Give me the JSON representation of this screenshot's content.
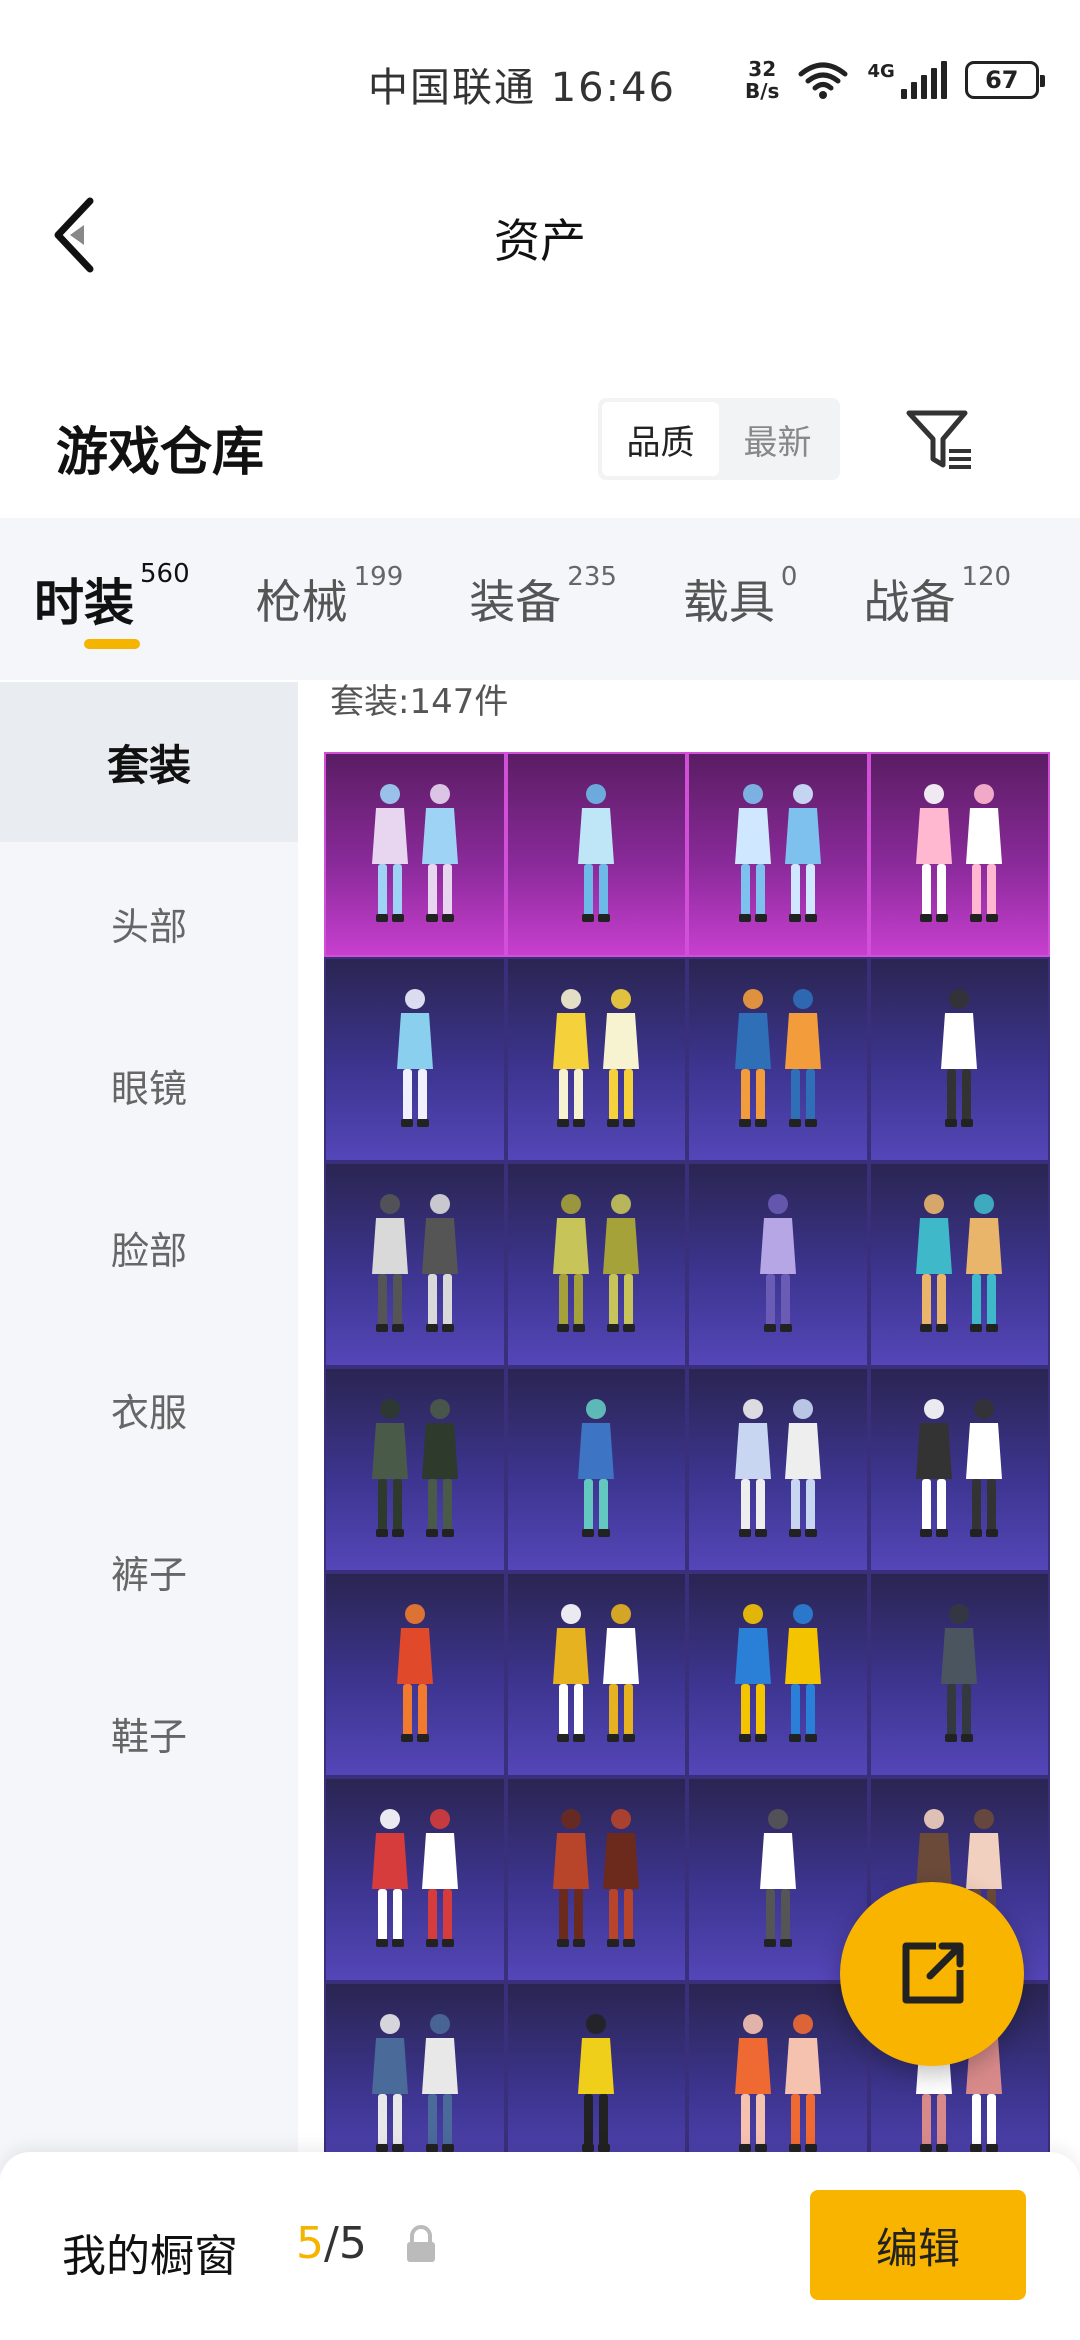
{
  "status_bar": {
    "carrier_time": "中国联通 16:46",
    "net_speed_value": "32",
    "net_speed_unit": "B/s",
    "network_type": "4G",
    "battery": "67"
  },
  "header": {
    "title": "资产"
  },
  "section": {
    "title": "游戏仓库",
    "sort_options": [
      "品质",
      "最新"
    ]
  },
  "tabs": [
    {
      "label": "时装",
      "count": "560"
    },
    {
      "label": "枪械",
      "count": "199"
    },
    {
      "label": "装备",
      "count": "235"
    },
    {
      "label": "载具",
      "count": "0"
    },
    {
      "label": "战备",
      "count": "120"
    }
  ],
  "sidebar": {
    "items": [
      "套装",
      "头部",
      "眼镜",
      "脸部",
      "衣服",
      "裤子",
      "鞋子"
    ]
  },
  "content": {
    "count_label": "套装:147件"
  },
  "bottom": {
    "showcase_label": "我的橱窗",
    "showcase_current": "5",
    "showcase_total": "/5",
    "edit_label": "编辑"
  },
  "colors": {
    "accent": "#f9b400",
    "legendary": "#c73fcf",
    "epic": "#4a3fa8"
  }
}
